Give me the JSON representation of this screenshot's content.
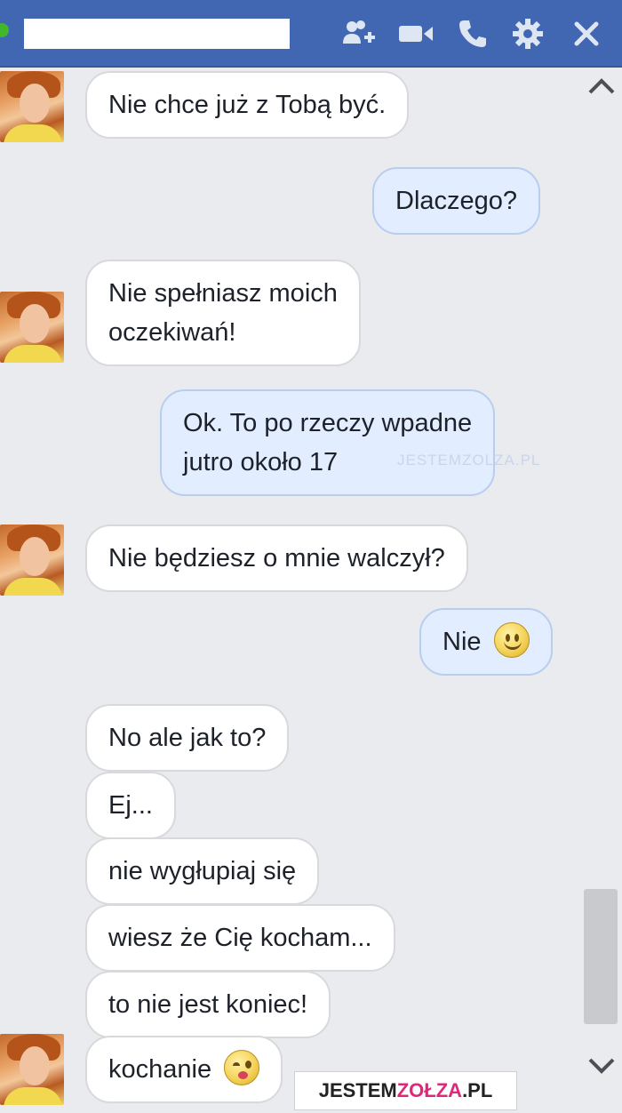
{
  "header": {
    "contact_name": "",
    "icons": [
      "add-people-icon",
      "video-call-icon",
      "phone-icon",
      "settings-gear-icon",
      "close-icon"
    ],
    "colors": {
      "bar": "#4267b2",
      "online": "#42b72a"
    }
  },
  "messages": [
    {
      "from": "them",
      "lines": [
        "Nie chce już z Tobą być."
      ]
    },
    {
      "from": "me",
      "lines": [
        "Dlaczego?"
      ]
    },
    {
      "from": "them",
      "lines": [
        "Nie spełniasz moich",
        "oczekiwań!"
      ]
    },
    {
      "from": "me",
      "lines": [
        "Ok. To po rzeczy wpadne",
        "jutro około 17"
      ]
    },
    {
      "from": "them",
      "lines": [
        "Nie będziesz o mnie walczył?"
      ]
    },
    {
      "from": "me",
      "lines": [
        "Nie"
      ],
      "emoji": "smile-emoji"
    },
    {
      "from": "them",
      "lines": [
        "No ale jak to?"
      ]
    },
    {
      "from": "them",
      "lines": [
        "Ej..."
      ]
    },
    {
      "from": "them",
      "lines": [
        "nie wygłupiaj się"
      ]
    },
    {
      "from": "them",
      "lines": [
        "wiesz że Cię kocham..."
      ]
    },
    {
      "from": "them",
      "lines": [
        "to nie jest koniec!"
      ]
    },
    {
      "from": "them",
      "lines": [
        "kochanie"
      ],
      "emoji": "kiss-emoji"
    }
  ],
  "watermark": {
    "inline_text": "JESTEMZOLZA.PL",
    "brand_prefix": "JESTEM",
    "brand_highlight": "ZOŁZA",
    "brand_suffix": ".PL"
  },
  "colors": {
    "incoming_bubble": "#ffffff",
    "outgoing_bubble": "#e2edff",
    "background": "#e9ebee"
  }
}
